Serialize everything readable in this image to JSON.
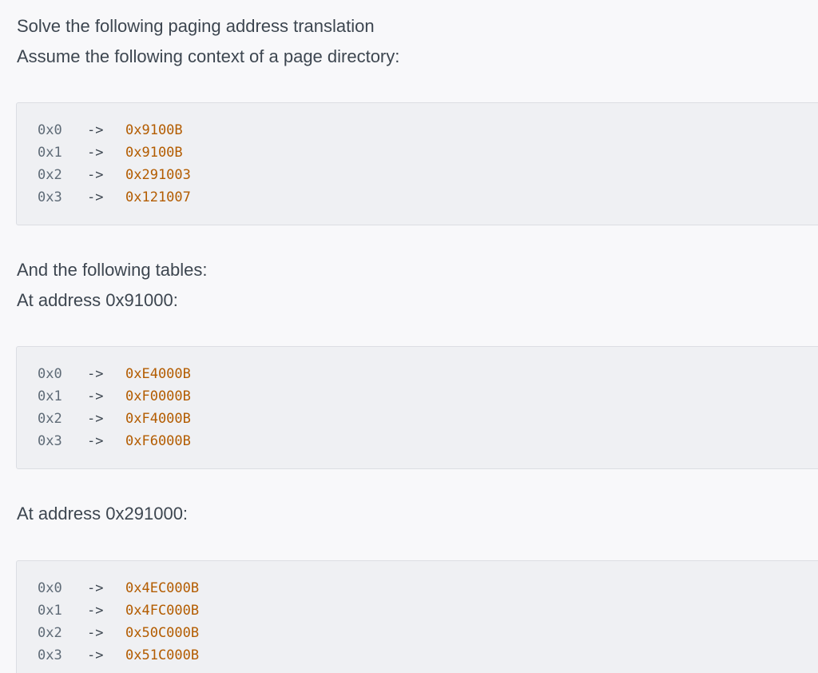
{
  "intro": {
    "line1": "Solve the following paging address translation",
    "line2": "Assume the following context of a page directory:"
  },
  "directory": {
    "rows": [
      {
        "index": "0x0",
        "arrow": "->",
        "value": "0x9100B"
      },
      {
        "index": "0x1",
        "arrow": "->",
        "value": "0x9100B"
      },
      {
        "index": "0x2",
        "arrow": "->",
        "value": "0x291003"
      },
      {
        "index": "0x3",
        "arrow": "->",
        "value": "0x121007"
      }
    ]
  },
  "tables_intro": "And the following tables:",
  "table1": {
    "heading": "At address 0x91000:",
    "rows": [
      {
        "index": "0x0",
        "arrow": "->",
        "value": "0xE4000B"
      },
      {
        "index": "0x1",
        "arrow": "->",
        "value": "0xF0000B"
      },
      {
        "index": "0x2",
        "arrow": "->",
        "value": "0xF4000B"
      },
      {
        "index": "0x3",
        "arrow": "->",
        "value": "0xF6000B"
      }
    ]
  },
  "table2": {
    "heading": "At address 0x291000:",
    "rows": [
      {
        "index": "0x0",
        "arrow": "->",
        "value": "0x4EC000B"
      },
      {
        "index": "0x1",
        "arrow": "->",
        "value": "0x4FC000B"
      },
      {
        "index": "0x2",
        "arrow": "->",
        "value": "0x50C000B"
      },
      {
        "index": "0x3",
        "arrow": "->",
        "value": "0x51C000B"
      }
    ]
  }
}
